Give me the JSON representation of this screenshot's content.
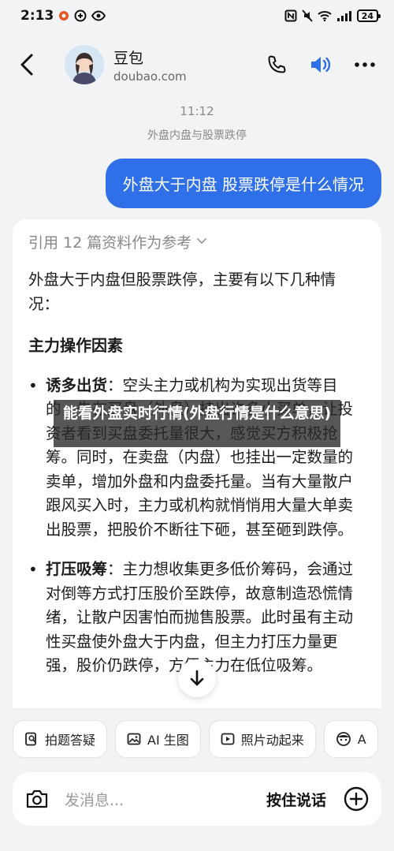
{
  "status_bar": {
    "time": "2:13",
    "battery": "24"
  },
  "header": {
    "name": "豆包",
    "subtitle": "doubao.com"
  },
  "conversation": {
    "timestamp": "11:12",
    "topic": "外盘内盘与股票跌停",
    "user_message": "外盘大于内盘  股票跌停是什么情况",
    "references_label": "引用 12 篇资料作为参考",
    "answer": {
      "intro": "外盘大于内盘但股票跌停，主要有以下几种情况：",
      "heading": "主力操作因素",
      "bullets": [
        {
          "title": "诱多出货",
          "text": "：空头主力或机构为实现出货等目的，先在买盘（外盘）挂出许多小买单，让投资者看到买盘委托量很大，感觉买方积极抢筹。同时，在卖盘（内盘）也挂出一定数量的卖单，增加外盘和内盘委托量。当有大量散户跟风买入时，主力或机构就悄悄用大量大单卖出股票，把股价不断往下砸，甚至砸到跌停。"
        },
        {
          "title": "打压吸筹",
          "text": "：主力想收集更多低价筹码，会通过对倒等方式打压股价至跌停，故意制造恐慌情绪，让散户因害怕而抛售股票。此时虽有主动性买盘使外盘大于内盘，但主力打压力量更强，股价仍跌停，方便主力在低位吸筹。"
        }
      ]
    }
  },
  "overlay_caption": "能看外盘实时行情(外盘行情是什么意思)",
  "quick_actions": [
    {
      "label": "拍题答疑",
      "icon": "photo-question-icon"
    },
    {
      "label": "AI 生图",
      "icon": "image-icon"
    },
    {
      "label": "照片动起来",
      "icon": "play-icon"
    },
    {
      "label": "A",
      "icon": "face-icon"
    }
  ],
  "input_bar": {
    "placeholder": "发消息...",
    "voice_label": "按住说话"
  },
  "colors": {
    "accent": "#2f6fe8",
    "background": "#f2f3f5"
  }
}
